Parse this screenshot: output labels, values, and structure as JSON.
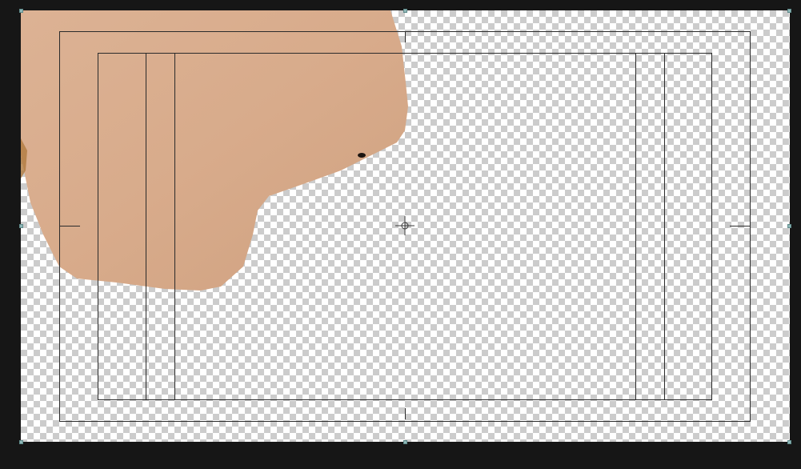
{
  "editor": {
    "mode": "free-transform",
    "canvas_background": "transparent-checkerboard",
    "colors": {
      "workspace": "#161616",
      "guide_line": "#2b2b2b",
      "handle": "#8fb8b8",
      "paper": "#d9ad8e"
    },
    "layer": {
      "name": "",
      "content": "torn-paper-image"
    },
    "icons": {
      "pivot": "transform-pivot-icon",
      "handles": "transform-handle-icon"
    }
  }
}
